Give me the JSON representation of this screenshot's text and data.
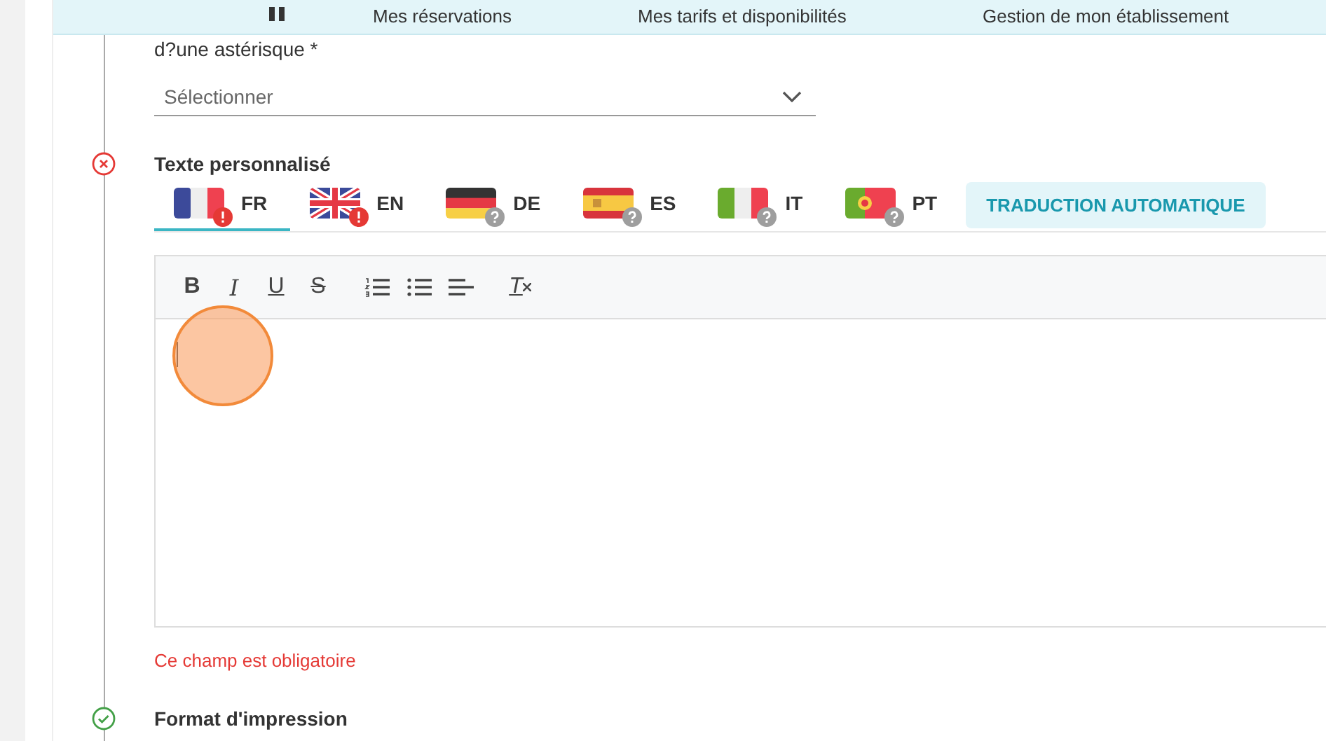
{
  "nav": {
    "items": [
      "Mes réservations",
      "Mes tarifs et disponibilités",
      "Gestion de mon établissement"
    ]
  },
  "field": {
    "label": "d?une astérisque *",
    "select": {
      "placeholder": "Sélectionner"
    }
  },
  "custom_text": {
    "title": "Texte personnalisé",
    "valid": false,
    "tabs": [
      {
        "code": "FR",
        "kind": "fr",
        "error": true,
        "selected": true
      },
      {
        "code": "EN",
        "kind": "gb",
        "error": true,
        "selected": false
      },
      {
        "code": "DE",
        "kind": "de",
        "error": false,
        "selected": false
      },
      {
        "code": "ES",
        "kind": "es",
        "error": false,
        "selected": false
      },
      {
        "code": "IT",
        "kind": "it",
        "error": false,
        "selected": false
      },
      {
        "code": "PT",
        "kind": "pt",
        "error": false,
        "selected": false
      }
    ],
    "translate_button": "TRADUCTION AUTOMATIQUE",
    "toolbar": [
      {
        "kind": "bold",
        "label": "B"
      },
      {
        "kind": "italic",
        "label": "I"
      },
      {
        "kind": "underline",
        "label": "U"
      },
      {
        "kind": "strike",
        "label": "S"
      },
      {
        "kind": "ordered"
      },
      {
        "kind": "bullet"
      },
      {
        "kind": "align"
      },
      {
        "kind": "clear",
        "label": "T"
      }
    ],
    "error": "Ce champ est obligatoire"
  },
  "next_section": {
    "title": "Format d'impression",
    "valid": true
  }
}
